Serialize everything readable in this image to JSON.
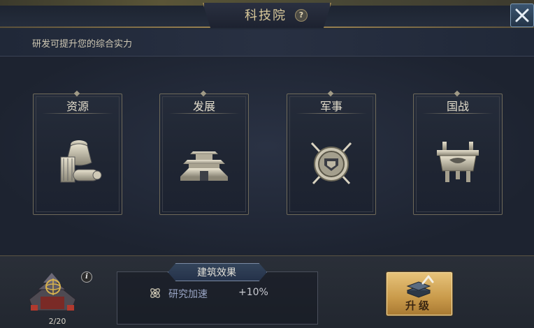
{
  "window": {
    "title": "科技院",
    "help_icon": "?",
    "close_icon": "close-icon",
    "subtitle": "研发可提升您的综合实力"
  },
  "categories": [
    {
      "label": "资源",
      "icon": "resource-bag-icon"
    },
    {
      "label": "发展",
      "icon": "palace-icon"
    },
    {
      "label": "军事",
      "icon": "crossed-swords-shield-icon"
    },
    {
      "label": "国战",
      "icon": "bronze-ding-icon"
    }
  ],
  "building": {
    "icon": "academy-building-icon",
    "info_icon": "i",
    "level": "2/20"
  },
  "effects": {
    "tab_label": "建筑效果",
    "items": [
      {
        "icon": "atom-icon",
        "name": "研究加速",
        "value": "+10%"
      }
    ]
  },
  "upgrade": {
    "label": "升级",
    "icon": "upgrade-books-arrow-icon"
  },
  "colors": {
    "accent_gold": "#d8c89a",
    "effect_name": "#9aa6c6",
    "upgrade_button": "#c99a4a"
  }
}
